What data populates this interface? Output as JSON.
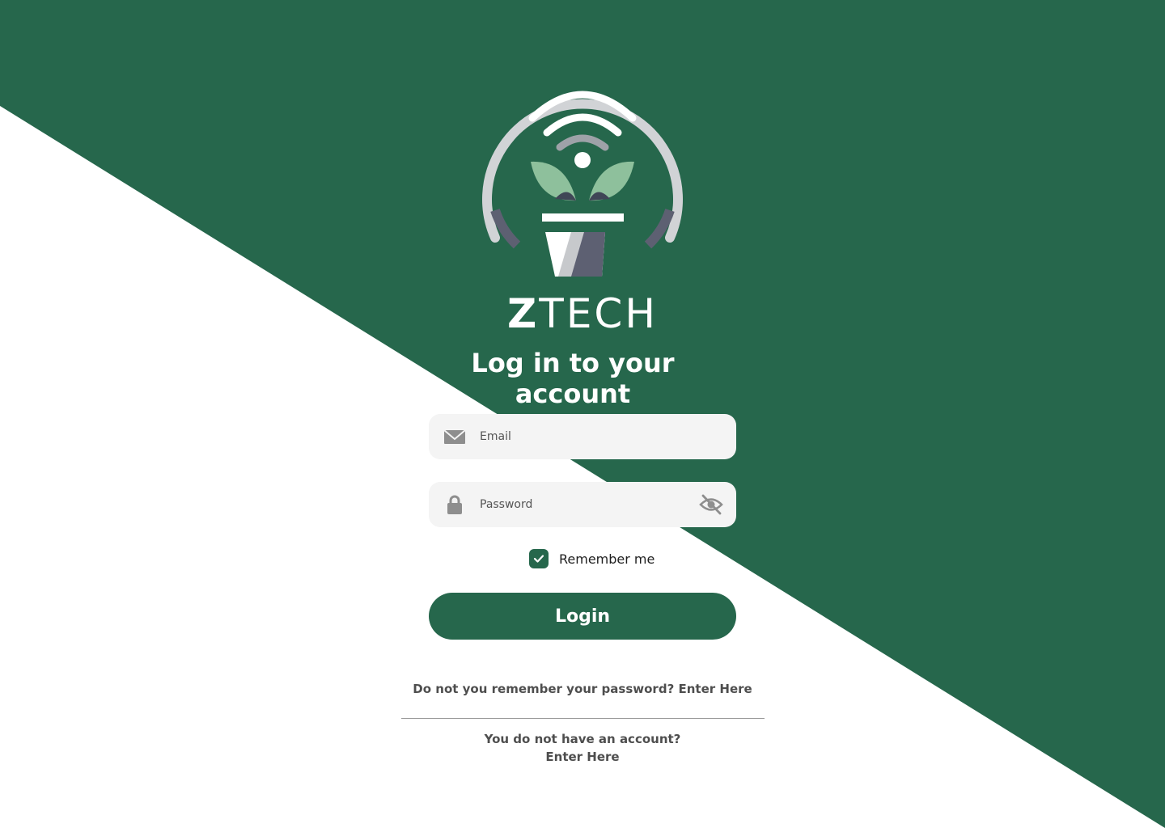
{
  "brand": {
    "name_prefix": "Z",
    "name_suffix": "TECH",
    "primary_color": "#26674c",
    "logo_icon": "smart-plant-bulb-logo"
  },
  "login": {
    "title": "Log in to your account",
    "email_placeholder": "Email",
    "email_icon": "mail-icon",
    "password_placeholder": "Password",
    "password_icon": "lock-icon",
    "visibility_icon": "eye-off-icon",
    "remember_label": "Remember me",
    "remember_checked": true,
    "submit_label": "Login",
    "forgot_text": "Do not you remember your password?",
    "forgot_link": "Enter Here",
    "signup_text": "You do not have an account?",
    "signup_link": "Enter Here"
  }
}
